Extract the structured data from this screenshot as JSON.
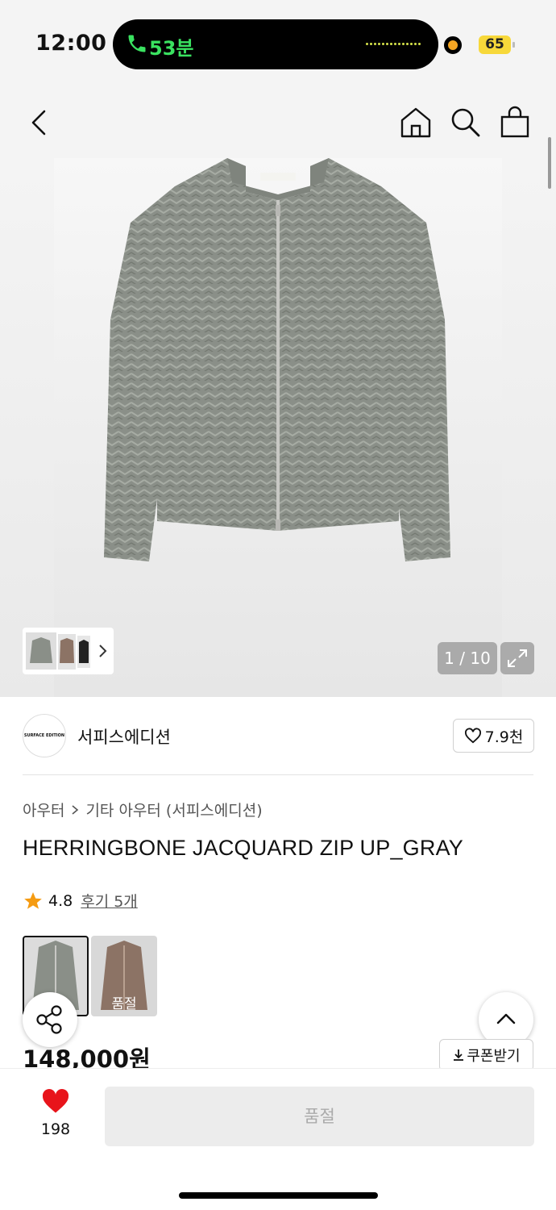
{
  "status_bar": {
    "time": "12:00",
    "call_duration": "53분",
    "battery": "65"
  },
  "nav": {
    "back_icon": "chevron-left-icon",
    "home_icon": "home-icon",
    "search_icon": "search-icon",
    "bag_icon": "shopping-bag-icon"
  },
  "gallery": {
    "counter": "1 / 10",
    "expand_icon": "expand-icon"
  },
  "brand": {
    "logo_text": "SURFACE EDITION",
    "name": "서피스에디션",
    "likes": "7.9천"
  },
  "breadcrumb": {
    "category": "아우터",
    "subcategory": "기타 아우터 (서피스에디션)"
  },
  "product": {
    "title": "HERRINGBONE JACQUARD ZIP UP_GRAY",
    "rating": "4.8",
    "reviews": "후기 5개",
    "price": "148,000원",
    "coupon_label": "쿠폰받기"
  },
  "options": [
    {
      "name": "gray",
      "soldout": ""
    },
    {
      "name": "brown",
      "soldout": "품절"
    }
  ],
  "bottom": {
    "wish_count": "198",
    "buy_label": "품절"
  },
  "colors": {
    "accent_green": "#3ae260",
    "battery": "#f7d83a",
    "heart_red": "#e8141b",
    "star": "#f59b12"
  }
}
